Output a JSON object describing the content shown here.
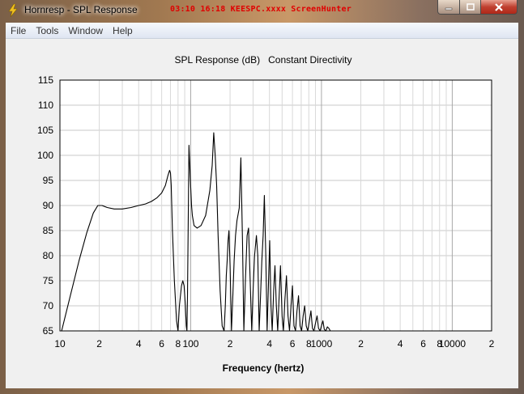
{
  "window": {
    "title": "Hornresp - SPL Response",
    "watermark": "03:10 16:18 KEESPC.xxxx ScreenHunter",
    "icons": {
      "app": "lightning-bolt-icon",
      "minimize": "minimize-icon",
      "maximize": "maximize-icon",
      "close": "close-icon"
    },
    "colors": {
      "close_button": "#c04030",
      "watermark": "#e00000"
    }
  },
  "menubar": {
    "items": [
      {
        "label": "File"
      },
      {
        "label": "Tools"
      },
      {
        "label": "Window"
      },
      {
        "label": "Help"
      }
    ]
  },
  "chart_data": {
    "type": "line",
    "title": "SPL Response (dB)   Constant Directivity",
    "xlabel": "Frequency (hertz)",
    "ylabel": "",
    "x_scale": "log",
    "xlim": [
      10,
      20000
    ],
    "ylim": [
      65,
      115
    ],
    "grid": true,
    "yticks": [
      65,
      70,
      75,
      80,
      85,
      90,
      95,
      100,
      105,
      110,
      115
    ],
    "xtick_labels": [
      {
        "value": 10,
        "label": "10"
      },
      {
        "value": 20,
        "label": "2"
      },
      {
        "value": 40,
        "label": "4"
      },
      {
        "value": 60,
        "label": "6"
      },
      {
        "value": 80,
        "label": "8"
      },
      {
        "value": 100,
        "label": "100"
      },
      {
        "value": 200,
        "label": "2"
      },
      {
        "value": 400,
        "label": "4"
      },
      {
        "value": 600,
        "label": "6"
      },
      {
        "value": 800,
        "label": "8"
      },
      {
        "value": 1000,
        "label": "1000"
      },
      {
        "value": 2000,
        "label": "2"
      },
      {
        "value": 4000,
        "label": "4"
      },
      {
        "value": 6000,
        "label": "6"
      },
      {
        "value": 8000,
        "label": "8"
      },
      {
        "value": 10000,
        "label": "10000"
      },
      {
        "value": 20000,
        "label": "2"
      }
    ],
    "series": [
      {
        "x": [
          10.3,
          12,
          14,
          16,
          18,
          19.5,
          21,
          23,
          26,
          30,
          35,
          40,
          45,
          50,
          55,
          60,
          64,
          67,
          69,
          70,
          71,
          72.5,
          75,
          78,
          80,
          82,
          85,
          87,
          89,
          91,
          92.5,
          93.5,
          94.5,
          96,
          97,
          99,
          101.5,
          103,
          106,
          112,
          120,
          130,
          140,
          146,
          150,
          154,
          158,
          162,
          168,
          174,
          180,
          184,
          187,
          190,
          193,
          196,
          200,
          205,
          210,
          215,
          220,
          226,
          235,
          242,
          249,
          255,
          262,
          270,
          277,
          285,
          293,
          300,
          308,
          318,
          326,
          334,
          342,
          350,
          358,
          366,
          375,
          384,
          393,
          402,
          411,
          420,
          431,
          441,
          452,
          463,
          475,
          486,
          500,
          512,
          525,
          540,
          555,
          570,
          585,
          600,
          616,
          633,
          650,
          668,
          686,
          705,
          724,
          744,
          765,
          786,
          808,
          830,
          853,
          876,
          900,
          925,
          950,
          975,
          1000,
          1025,
          1050,
          1080,
          1110,
          1140,
          1170
        ],
        "y": [
          65,
          72,
          79,
          84.5,
          88.5,
          90,
          90,
          89.6,
          89.3,
          89.3,
          89.6,
          90,
          90.3,
          90.8,
          91.5,
          92.5,
          94,
          96,
          97,
          96.5,
          94,
          85,
          75,
          67,
          65,
          70,
          74,
          75,
          74,
          70,
          66,
          65,
          72,
          90,
          102,
          96,
          90,
          88,
          86,
          85.5,
          86,
          88,
          93,
          98,
          104.5,
          100,
          94,
          84,
          73,
          66,
          65,
          70,
          76,
          79,
          83,
          85,
          78,
          65,
          72,
          79,
          84,
          87,
          89.5,
          99.5,
          83,
          65,
          75,
          84,
          85.5,
          75,
          65,
          73,
          80,
          84,
          80,
          65,
          72,
          79,
          84,
          92,
          80,
          65,
          74,
          83,
          70,
          65,
          73,
          78,
          70,
          65,
          72,
          78,
          68,
          65,
          71,
          76,
          68,
          65,
          70,
          74,
          66,
          65,
          69,
          72,
          66,
          65,
          68,
          70,
          66,
          65,
          67,
          69,
          65.5,
          65,
          66.5,
          68,
          65.5,
          65,
          66,
          67,
          65.3,
          65,
          65.8,
          65.5,
          65
        ]
      }
    ]
  }
}
